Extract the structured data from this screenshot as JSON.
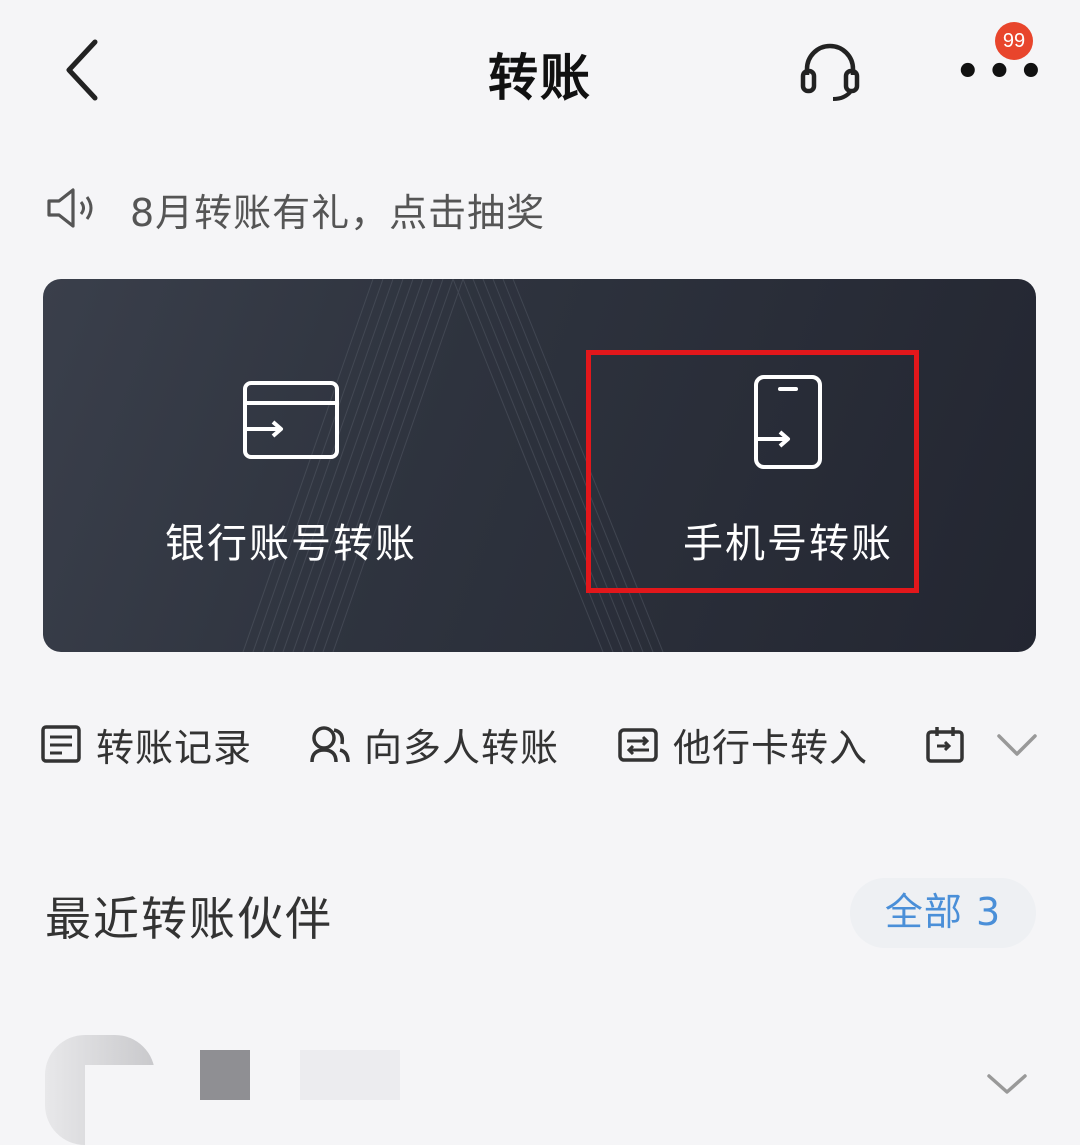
{
  "header": {
    "title": "转账",
    "badge_count": "99",
    "more_dots": "•••"
  },
  "notice": {
    "text": "8月转账有礼，点击抽奖"
  },
  "card": {
    "options": [
      {
        "label": "银行账号转账",
        "icon": "bank-card-transfer-icon"
      },
      {
        "label": "手机号转账",
        "icon": "phone-transfer-icon"
      }
    ],
    "highlight_color": "#e2171b"
  },
  "quick_actions": [
    {
      "label": "转账记录",
      "icon": "record-list-icon"
    },
    {
      "label": "向多人转账",
      "icon": "multi-person-icon"
    },
    {
      "label": "他行卡转入",
      "icon": "card-exchange-icon"
    },
    {
      "label": "",
      "icon": "calendar-icon"
    }
  ],
  "recent": {
    "title": "最近转账伙伴",
    "all_label": "全部 3"
  },
  "colors": {
    "accent": "#4a8fd8",
    "badge": "#e8452c",
    "card_bg": "#2e333e"
  }
}
